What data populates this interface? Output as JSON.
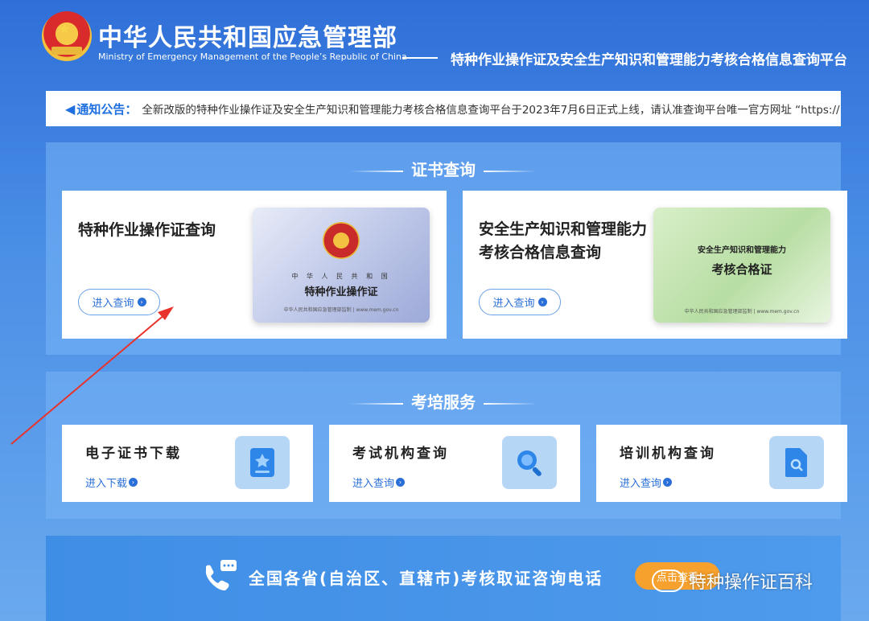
{
  "header": {
    "title_cn": "中华人民共和国应急管理部",
    "title_en": "Ministry of Emergency Management of the People’s Republic of China",
    "subtitle": "特种作业操作证及安全生产知识和管理能力考核合格信息查询平台"
  },
  "notice": {
    "label": "通知公告：",
    "text": "全新改版的特种作业操作证及安全生产知识和管理能力考核合格信息查询平台于2023年7月6日正式上线，请认准查询平台唯一官方网址 “https://"
  },
  "cert_section": {
    "title": "证书查询",
    "cards": [
      {
        "title": "特种作业操作证查询",
        "button": "进入查询",
        "cert": {
          "line1": "中 华 人 民 共 和 国",
          "line2": "特种作业操作证",
          "line3": "中华人民共和国应急管理部监制 | www.mem.gov.cn"
        }
      },
      {
        "title_line1": "安全生产知识和管理能力",
        "title_line2": "考核合格信息查询",
        "button": "进入查询",
        "cert": {
          "line1": "安全生产知识和管理能力",
          "line2": "考核合格证",
          "line3": "中华人民共和国应急管理部监制 | www.mem.gov.cn"
        }
      }
    ]
  },
  "service_section": {
    "title": "考培服务",
    "items": [
      {
        "title": "电子证书下载",
        "link": "进入下载",
        "icon": "certificate-icon"
      },
      {
        "title": "考试机构查询",
        "link": "进入查询",
        "icon": "magnifier-icon"
      },
      {
        "title": "培训机构查询",
        "link": "进入查询",
        "icon": "document-search-icon"
      }
    ]
  },
  "banner": {
    "text": "全国各省(自治区、直辖市)考核取证咨询电话",
    "button": "点击查看"
  },
  "watermark": "特种操作证百科",
  "annotation_color": "#e8322c"
}
